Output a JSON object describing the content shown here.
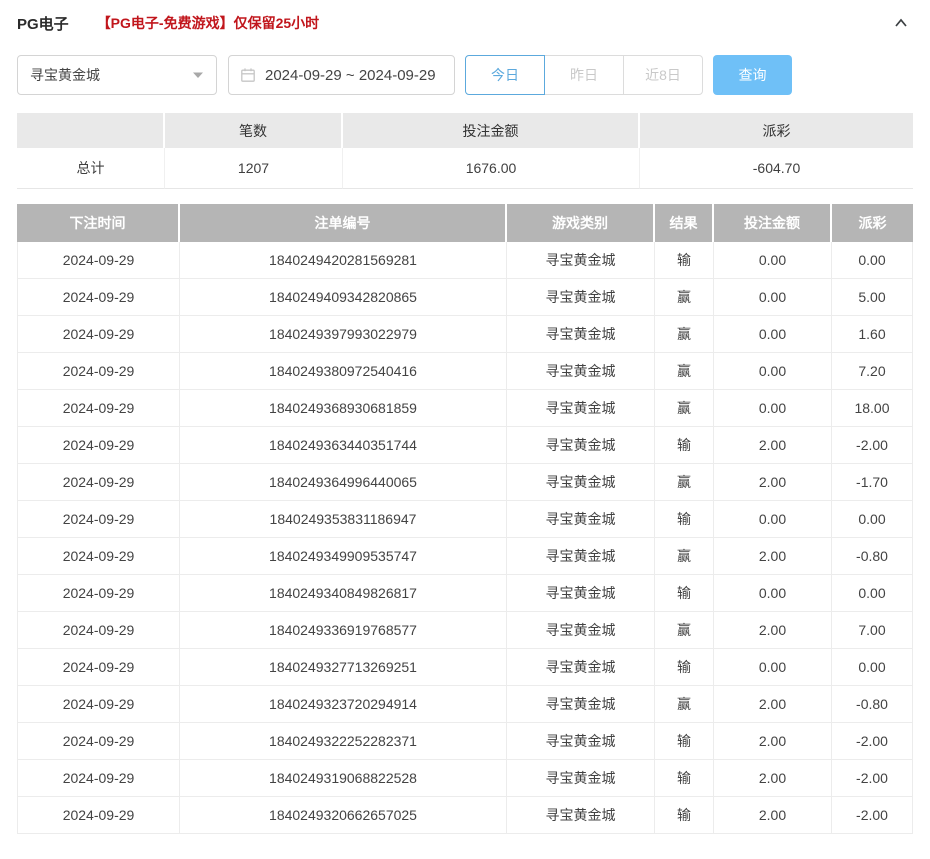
{
  "header": {
    "title": "PG电子",
    "notice": "【PG电子-免费游戏】仅保留25小时"
  },
  "filters": {
    "game_select": {
      "value": "寻宝黄金城"
    },
    "date_range": {
      "value": "2024-09-29 ~ 2024-09-29"
    },
    "quick_buttons": [
      {
        "label": "今日",
        "active": true
      },
      {
        "label": "昨日",
        "active": false
      },
      {
        "label": "近8日",
        "active": false
      }
    ],
    "search_button_label": "查询"
  },
  "summary": {
    "headers": [
      "",
      "笔数",
      "投注金额",
      "派彩"
    ],
    "row_label": "总计",
    "bet_count": "1207",
    "bet_amount": "1676.00",
    "payout": "-604.70"
  },
  "table": {
    "headers": [
      "下注时间",
      "注单编号",
      "游戏类别",
      "结果",
      "投注金额",
      "派彩"
    ],
    "rows": [
      [
        "2024-09-29",
        "1840249420281569281",
        "寻宝黄金城",
        "输",
        "0.00",
        "0.00"
      ],
      [
        "2024-09-29",
        "1840249409342820865",
        "寻宝黄金城",
        "赢",
        "0.00",
        "5.00"
      ],
      [
        "2024-09-29",
        "1840249397993022979",
        "寻宝黄金城",
        "赢",
        "0.00",
        "1.60"
      ],
      [
        "2024-09-29",
        "1840249380972540416",
        "寻宝黄金城",
        "赢",
        "0.00",
        "7.20"
      ],
      [
        "2024-09-29",
        "1840249368930681859",
        "寻宝黄金城",
        "赢",
        "0.00",
        "18.00"
      ],
      [
        "2024-09-29",
        "1840249363440351744",
        "寻宝黄金城",
        "输",
        "2.00",
        "-2.00"
      ],
      [
        "2024-09-29",
        "1840249364996440065",
        "寻宝黄金城",
        "赢",
        "2.00",
        "-1.70"
      ],
      [
        "2024-09-29",
        "1840249353831186947",
        "寻宝黄金城",
        "输",
        "0.00",
        "0.00"
      ],
      [
        "2024-09-29",
        "1840249349909535747",
        "寻宝黄金城",
        "赢",
        "2.00",
        "-0.80"
      ],
      [
        "2024-09-29",
        "1840249340849826817",
        "寻宝黄金城",
        "输",
        "0.00",
        "0.00"
      ],
      [
        "2024-09-29",
        "1840249336919768577",
        "寻宝黄金城",
        "赢",
        "2.00",
        "7.00"
      ],
      [
        "2024-09-29",
        "1840249327713269251",
        "寻宝黄金城",
        "输",
        "0.00",
        "0.00"
      ],
      [
        "2024-09-29",
        "1840249323720294914",
        "寻宝黄金城",
        "赢",
        "2.00",
        "-0.80"
      ],
      [
        "2024-09-29",
        "1840249322252282371",
        "寻宝黄金城",
        "输",
        "2.00",
        "-2.00"
      ],
      [
        "2024-09-29",
        "1840249319068822528",
        "寻宝黄金城",
        "输",
        "2.00",
        "-2.00"
      ],
      [
        "2024-09-29",
        "1840249320662657025",
        "寻宝黄金城",
        "输",
        "2.00",
        "-2.00"
      ]
    ]
  },
  "colors": {
    "accent_blue": "#6fc0f7",
    "active_tab_blue": "#5ca9dd",
    "notice_red": "#c1161c",
    "negative_red": "#e95c6b",
    "table_header_gray": "#b5b5b5",
    "summary_header_gray": "#e9e9e9"
  }
}
